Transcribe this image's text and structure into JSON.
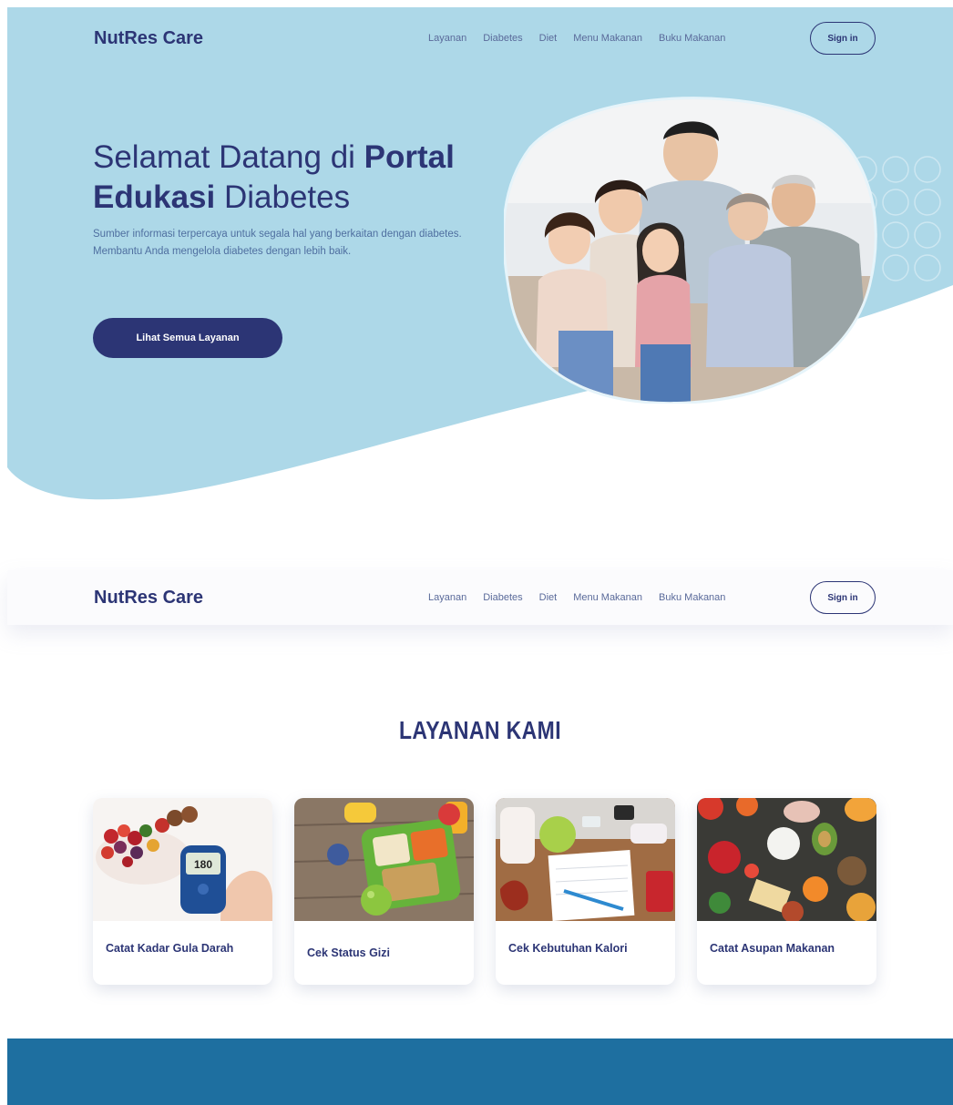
{
  "nav": {
    "brand": "NutRes Care",
    "items": [
      "Layanan",
      "Diabetes",
      "Diet",
      "Menu Makanan",
      "Buku Makanan"
    ],
    "signin": "Sign in"
  },
  "hero": {
    "title_part1": "Selamat Datang di ",
    "title_bold1": "Portal",
    "title_bold2": "Edukasi",
    "title_part2": " Diabetes",
    "description": "Sumber informasi terpercaya untuk segala hal yang berkaitan dengan diabetes. Membantu Anda mengelola diabetes dengan lebih baik.",
    "cta": "Lihat Semua Layanan"
  },
  "services": {
    "title": "LAYANAN KAMI",
    "cards": [
      {
        "label": "Catat Kadar Gula Darah",
        "meter_reading": "180"
      },
      {
        "label": "Cek Status Gizi"
      },
      {
        "label": "Cek Kebutuhan Kalori"
      },
      {
        "label": "Catat Asupan Makanan"
      }
    ]
  },
  "colors": {
    "primary": "#2c3575",
    "hero_bg": "#add8e8",
    "footer": "#1e6fa0"
  }
}
